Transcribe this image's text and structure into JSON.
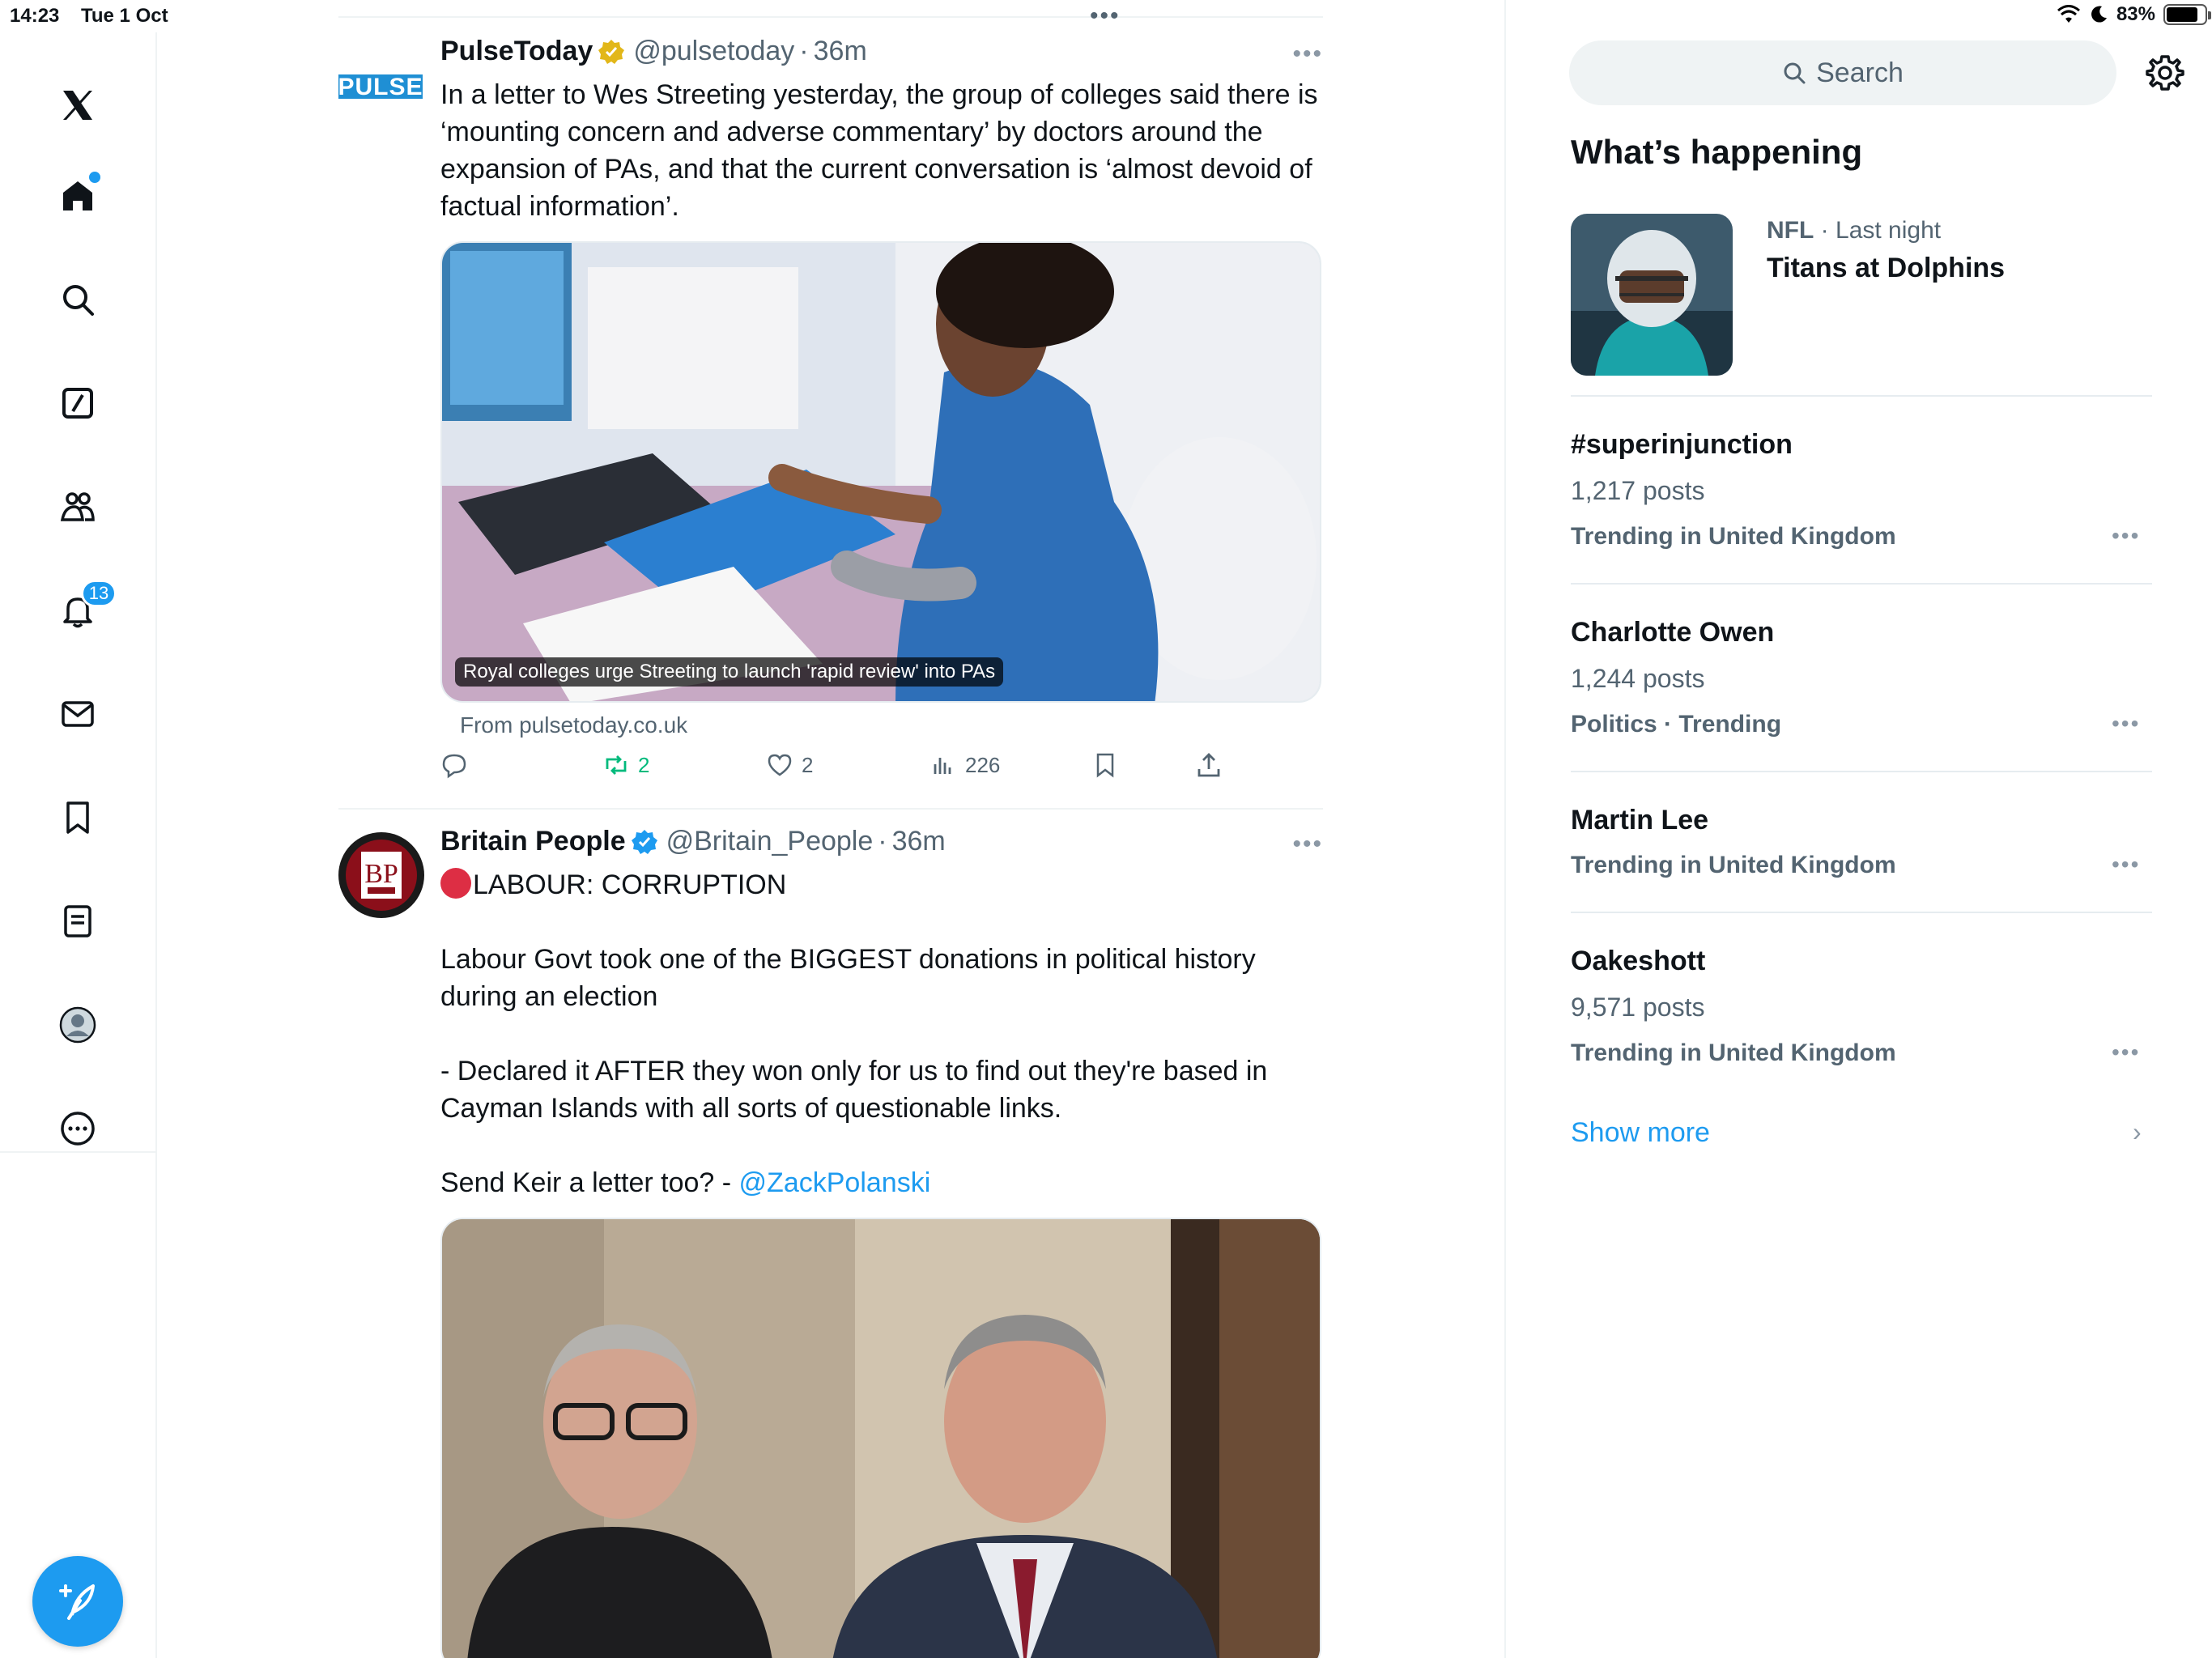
{
  "status_bar": {
    "time": "14:23",
    "date": "Tue 1 Oct",
    "battery": "83%",
    "battery_level": 0.83
  },
  "nav": {
    "notifications_count": "13",
    "items": [
      "x-logo-icon",
      "home-icon",
      "search-icon",
      "grok-icon",
      "communities-icon",
      "notifications-icon",
      "messages-icon",
      "bookmarks-icon",
      "lists-icon",
      "profile-icon",
      "more-icon"
    ]
  },
  "tweets": [
    {
      "name": "PulseToday",
      "handle": "@pulsetoday",
      "sep": "·",
      "time": "36m",
      "avatar_text": "PULSE",
      "text": "In a letter to Wes Streeting yesterday, the group of colleges said there is ‘mounting concern and adverse commentary’ by doctors around the expansion of PAs, and that the current conversation is ‘almost devoid of factual information’.",
      "card_caption": "Royal colleges urge Streeting to launch 'rapid review' into PAs",
      "card_source": "From pulsetoday.co.uk",
      "retweets": "2",
      "likes": "2",
      "views": "226"
    },
    {
      "name": "Britain People",
      "handle": "@Britain_People",
      "sep": "·",
      "time": "36m",
      "avatar_text": "BP",
      "text_line1": "LABOUR: CORRUPTION",
      "text_body": "Labour Govt took one of the BIGGEST donations in political history during an election\n\n- Declared it AFTER they won only for us to find out they're based in Cayman Islands with all sorts of questionable links.\n\nSend Keir a letter too? - ",
      "mention": "@ZackPolanski"
    }
  ],
  "sidebar": {
    "search_placeholder": "Search",
    "section_title": "What’s happening",
    "featured": {
      "category": "NFL",
      "sep": "·",
      "when": "Last night",
      "title": "Titans at Dolphins"
    },
    "trends": [
      {
        "name": "#superinjunction",
        "count": "1,217 posts",
        "context": "Trending in United Kingdom"
      },
      {
        "name": "Charlotte Owen",
        "count": "1,244 posts",
        "context": "Politics · Trending"
      },
      {
        "name": "Martin Lee",
        "count": "",
        "context": "Trending in United Kingdom"
      },
      {
        "name": "Oakeshott",
        "count": "9,571 posts",
        "context": "Trending in United Kingdom"
      }
    ],
    "show_more": "Show more"
  },
  "colors": {
    "accent": "#1d9bf0",
    "retweet_active": "#00ba7c",
    "secondary_text": "#536471",
    "divider": "#eff3f4"
  }
}
